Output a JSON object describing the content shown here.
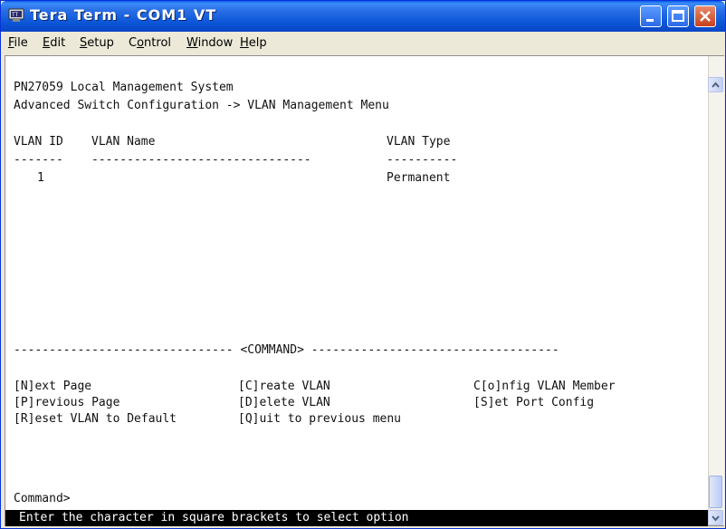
{
  "window": {
    "title": "Tera Term - COM1 VT",
    "icon": "terminal-app-icon",
    "buttons": [
      "minimize-icon",
      "maximize-icon",
      "close-icon"
    ]
  },
  "menubar": {
    "items": [
      {
        "label": "File",
        "mnemonic": "F"
      },
      {
        "label": "Edit",
        "mnemonic": "E"
      },
      {
        "label": "Setup",
        "mnemonic": "S"
      },
      {
        "label": "Control",
        "mnemonic": "o"
      },
      {
        "label": "Window",
        "mnemonic": "W"
      },
      {
        "label": "Help",
        "mnemonic": "H"
      }
    ]
  },
  "terminal": {
    "system_title": "PN27059 Local Management System",
    "breadcrumb": "Advanced Switch Configuration -> VLAN Management Menu",
    "table": {
      "headers": [
        "VLAN ID",
        "VLAN Name",
        "VLAN Type"
      ],
      "separators": [
        "-------",
        "-------------------------------",
        "----------"
      ],
      "rows": [
        {
          "id": "1",
          "name": "",
          "type": "Permanent"
        }
      ]
    },
    "command_divider": "------------------------------- <COMMAND> -----------------------------------",
    "commands": [
      [
        "[N]ext Page",
        "[C]reate VLAN",
        "C[o]nfig VLAN Member"
      ],
      [
        "[P]revious Page",
        "[D]elete VLAN",
        "[S]et Port Config"
      ],
      [
        "[R]eset VLAN to Default",
        "[Q]uit to previous menu",
        ""
      ]
    ],
    "prompt": "Command>",
    "status_line": "Enter the character in square brackets to select option"
  }
}
